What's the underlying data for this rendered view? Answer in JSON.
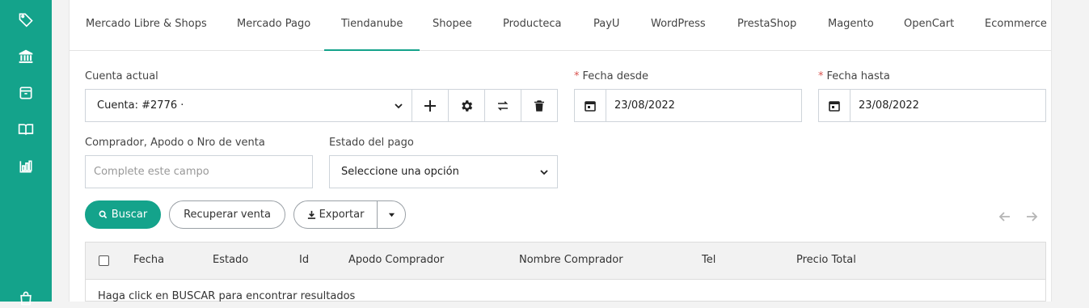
{
  "sidebar": {
    "icons": [
      "tag-icon",
      "bank-icon",
      "package-icon",
      "book-icon",
      "chart-icon",
      "bag-icon"
    ]
  },
  "tabs": [
    {
      "label": "Mercado Libre & Shops"
    },
    {
      "label": "Mercado Pago"
    },
    {
      "label": "Tiendanube",
      "active": true
    },
    {
      "label": "Shopee"
    },
    {
      "label": "Producteca"
    },
    {
      "label": "PayU"
    },
    {
      "label": "WordPress"
    },
    {
      "label": "PrestaShop"
    },
    {
      "label": "Magento"
    },
    {
      "label": "OpenCart"
    },
    {
      "label": "Ecommerce"
    }
  ],
  "form": {
    "account_label": "Cuenta actual",
    "account_value": "Cuenta: #2776 ·",
    "date_from_label": "Fecha desde",
    "date_from_value": "23/08/2022",
    "date_to_label": "Fecha hasta",
    "date_to_value": "23/08/2022",
    "buyer_label": "Comprador, Apodo o Nro de venta",
    "buyer_placeholder": "Complete este campo",
    "payment_label": "Estado del pago",
    "payment_value": "Seleccione una opción",
    "required_mark": "*"
  },
  "actions": {
    "search": "Buscar",
    "recover": "Recuperar venta",
    "export": "Exportar"
  },
  "table": {
    "columns": [
      "Fecha",
      "Estado",
      "Id",
      "Apodo Comprador",
      "Nombre Comprador",
      "Tel",
      "Precio Total"
    ],
    "empty_message": "Haga click en BUSCAR para encontrar resultados"
  },
  "colors": {
    "brand": "#14a38b",
    "required": "#d9534f"
  }
}
